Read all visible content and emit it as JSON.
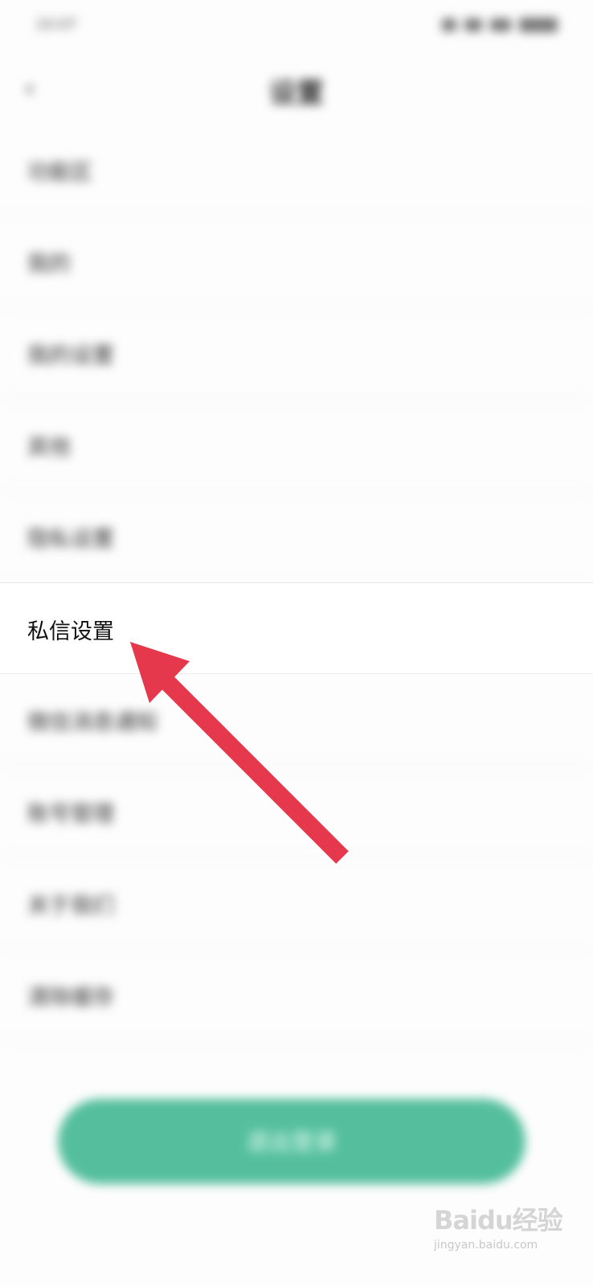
{
  "status_bar": {
    "time": "10:07"
  },
  "header": {
    "title": "设置",
    "back_icon": "back-arrow-icon"
  },
  "settings_list": [
    {
      "label": "功能区"
    },
    {
      "label": "我的"
    },
    {
      "label": "我的设置"
    },
    {
      "label": "其他"
    },
    {
      "label": "隐私设置"
    },
    {
      "label": "私信设置"
    },
    {
      "label": "微信消息通知"
    },
    {
      "label": "账号管理"
    },
    {
      "label": "关于我们"
    },
    {
      "label": "清除缓存"
    }
  ],
  "logout_button": {
    "label": "退出登录"
  },
  "footer": {
    "text": ""
  },
  "watermark": {
    "logo": "Baidu经验",
    "sub": "jingyan.baidu.com"
  },
  "colors": {
    "accent": "#55bf9d",
    "arrow": "#e6384c"
  }
}
